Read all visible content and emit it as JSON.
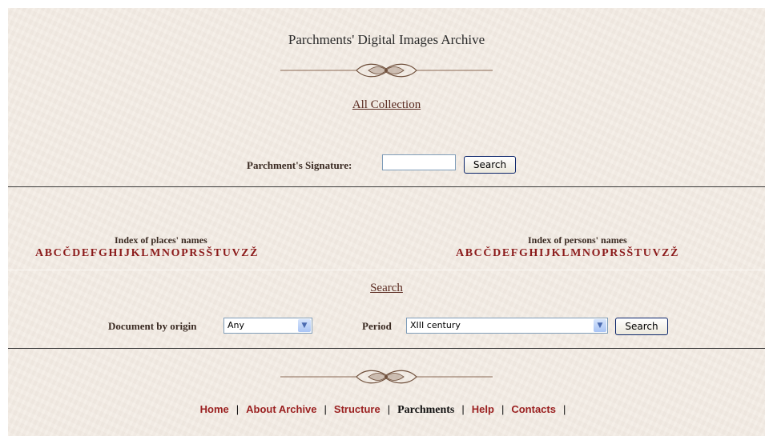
{
  "header": {
    "title": "Parchments' Digital Images Archive",
    "all_collection_link": "All Collection"
  },
  "signature_search": {
    "label": "Parchment's Signature:",
    "input_value": "",
    "button_label": "Search"
  },
  "places_index": {
    "title": "Index of places' names",
    "letters": [
      "A",
      "B",
      "C",
      "Č",
      "D",
      "E",
      "F",
      "G",
      "H",
      "I",
      "J",
      "K",
      "L",
      "M",
      "N",
      "O",
      "P",
      "R",
      "S",
      "Š",
      "T",
      "U",
      "V",
      "Z",
      "Ž"
    ]
  },
  "persons_index": {
    "title": "Index of persons' names",
    "letters": [
      "A",
      "B",
      "C",
      "Č",
      "D",
      "E",
      "F",
      "G",
      "H",
      "I",
      "J",
      "K",
      "L",
      "M",
      "N",
      "O",
      "P",
      "R",
      "S",
      "Š",
      "T",
      "U",
      "V",
      "Z",
      "Ž"
    ]
  },
  "search": {
    "link": "Search",
    "origin_label": "Document by origin",
    "origin_value": "Any",
    "period_label": "Period",
    "period_value": "XIII century",
    "button_label": "Search"
  },
  "footer_nav": {
    "items": [
      "Home",
      "About Archive",
      "Structure",
      "Parchments",
      "Help",
      "Contacts"
    ],
    "current": "Parchments",
    "separator": "|"
  },
  "colors": {
    "background": "#f3ece4",
    "link_red": "#9a1f1f",
    "letters_red": "#8b1a1a",
    "ornament": "#7a5a45"
  }
}
